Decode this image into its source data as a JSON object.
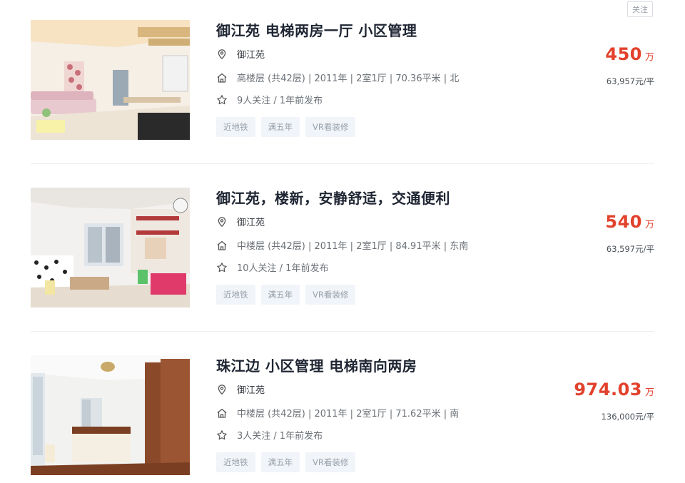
{
  "follow_button": "关注",
  "listings": [
    {
      "title": "御江苑 电梯两房一厅 小区管理",
      "community": "御江苑",
      "info": "高楼层 (共42层) | 2011年 | 2室1厅 | 70.36平米 | 北",
      "follow": "9人关注 / 1年前发布",
      "tags": [
        "近地铁",
        "满五年",
        "VR看装修"
      ],
      "price": "450",
      "price_unit": "万",
      "unit_price": "63,957元/平"
    },
    {
      "title": "御江苑，楼新，安静舒适，交通便利",
      "community": "御江苑",
      "info": "中楼层 (共42层) | 2011年 | 2室1厅 | 84.91平米 | 东南",
      "follow": "10人关注 / 1年前发布",
      "tags": [
        "近地铁",
        "满五年",
        "VR看装修"
      ],
      "price": "540",
      "price_unit": "万",
      "unit_price": "63,597元/平"
    },
    {
      "title": "珠江边 小区管理 电梯南向两房",
      "community": "御江苑",
      "info": "中楼层 (共42层) | 2011年 | 2室1厅 | 71.62平米 | 南",
      "follow": "3人关注 / 1年前发布",
      "tags": [
        "近地铁",
        "满五年",
        "VR看装修"
      ],
      "price": "974.03",
      "price_unit": "万",
      "unit_price": "136,000元/平"
    }
  ],
  "icons": {
    "community": "location-pin-icon",
    "info": "house-icon",
    "follow": "star-icon"
  },
  "colors": {
    "price": "#e2412c",
    "title": "#1f2633",
    "tag_bg": "#f1f4f8",
    "tag_text": "#97a0aa"
  }
}
